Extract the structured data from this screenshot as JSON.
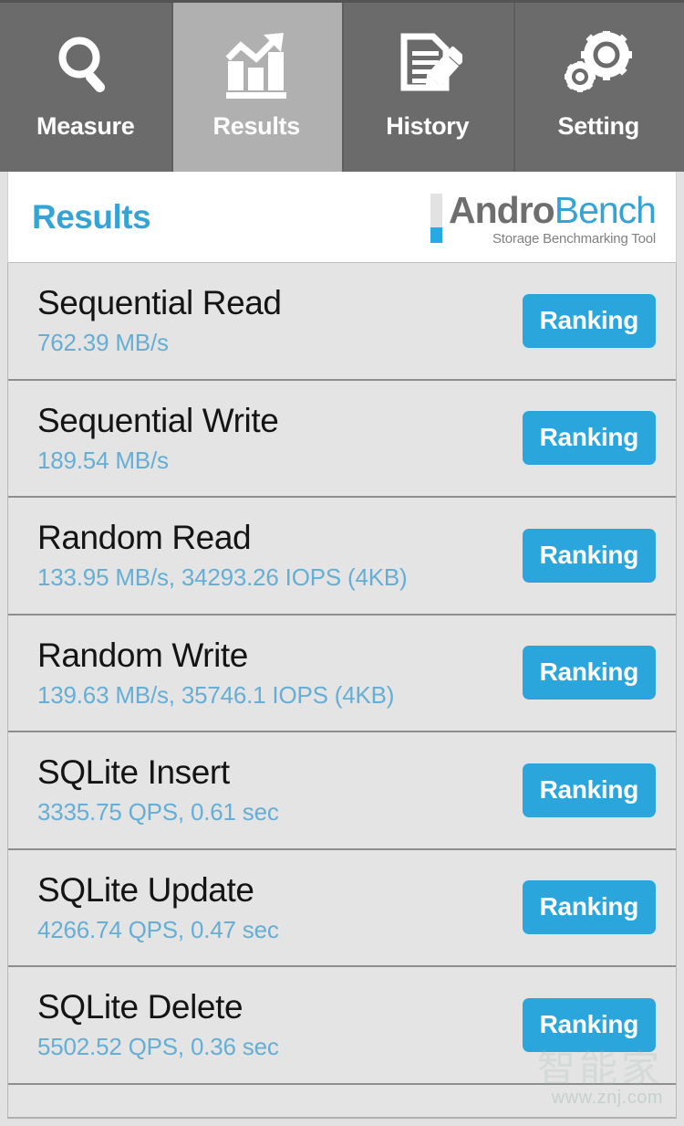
{
  "nav": {
    "tabs": [
      {
        "label": "Measure",
        "icon": "magnifier-icon",
        "active": false
      },
      {
        "label": "Results",
        "icon": "bar-chart-arrow-icon",
        "active": true
      },
      {
        "label": "History",
        "icon": "document-pencil-icon",
        "active": false
      },
      {
        "label": "Setting",
        "icon": "gears-icon",
        "active": false
      }
    ]
  },
  "header": {
    "title": "Results",
    "logo": {
      "primary": "Andro",
      "secondary": "Bench",
      "tagline": "Storage Benchmarking Tool"
    }
  },
  "results": {
    "ranking_label": "Ranking",
    "rows": [
      {
        "name": "Sequential Read",
        "value": "762.39 MB/s"
      },
      {
        "name": "Sequential Write",
        "value": "189.54 MB/s"
      },
      {
        "name": "Random Read",
        "value": "133.95 MB/s, 34293.26 IOPS (4KB)"
      },
      {
        "name": "Random Write",
        "value": "139.63 MB/s, 35746.1 IOPS (4KB)"
      },
      {
        "name": "SQLite Insert",
        "value": "3335.75 QPS, 0.61 sec"
      },
      {
        "name": "SQLite Update",
        "value": "4266.74 QPS, 0.47 sec"
      },
      {
        "name": "SQLite Delete",
        "value": "5502.52 QPS, 0.36 sec"
      }
    ]
  },
  "watermark": {
    "text": "智能家",
    "url": "www.znj.com"
  },
  "colors": {
    "accent_blue": "#2ba6dd",
    "title_blue": "#35a4d4",
    "value_blue": "#66aed4",
    "nav_bg": "#6b6b6b",
    "nav_active_bg": "#b0b0b0",
    "row_bg": "#e4e4e4",
    "logo_gray": "#6e6e6e"
  }
}
